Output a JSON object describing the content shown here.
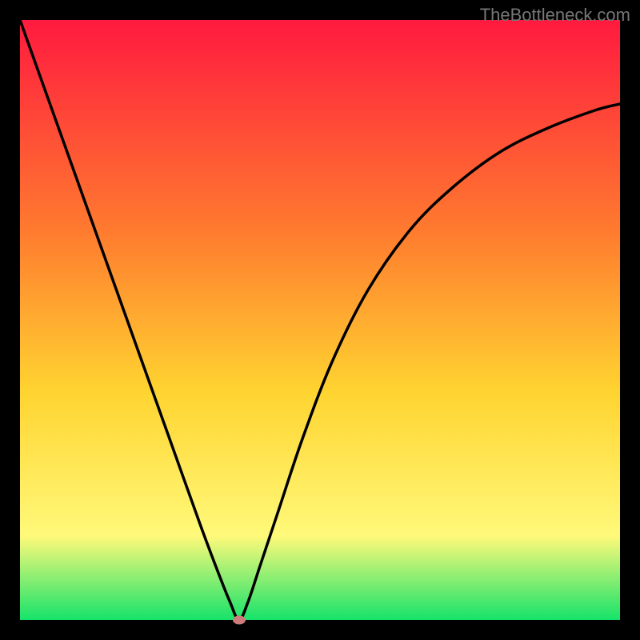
{
  "watermark": "TheBottleneck.com",
  "chart_data": {
    "type": "line",
    "title": "",
    "xlabel": "",
    "ylabel": "",
    "xlim": [
      0,
      100
    ],
    "ylim": [
      0,
      100
    ],
    "grid": false,
    "legend": false,
    "background_gradient": {
      "top": "#ff1a3f",
      "mid_upper": "#ff7a2f",
      "mid": "#ffd430",
      "lower": "#fff97a",
      "bottom": "#16e36a"
    },
    "series": [
      {
        "name": "bottleneck-curve",
        "color": "#000000",
        "x": [
          0,
          5,
          10,
          15,
          20,
          25,
          30,
          33,
          35,
          36.5,
          38,
          40,
          43,
          47,
          52,
          58,
          65,
          72,
          80,
          88,
          96,
          100
        ],
        "y": [
          100,
          86,
          72,
          58,
          44,
          30,
          16,
          8,
          3,
          0,
          3,
          9,
          18,
          30,
          43,
          55,
          65,
          72,
          78,
          82,
          85,
          86
        ]
      }
    ],
    "marker": {
      "x": 36.5,
      "y": 0,
      "color": "#cd7b7b"
    }
  }
}
